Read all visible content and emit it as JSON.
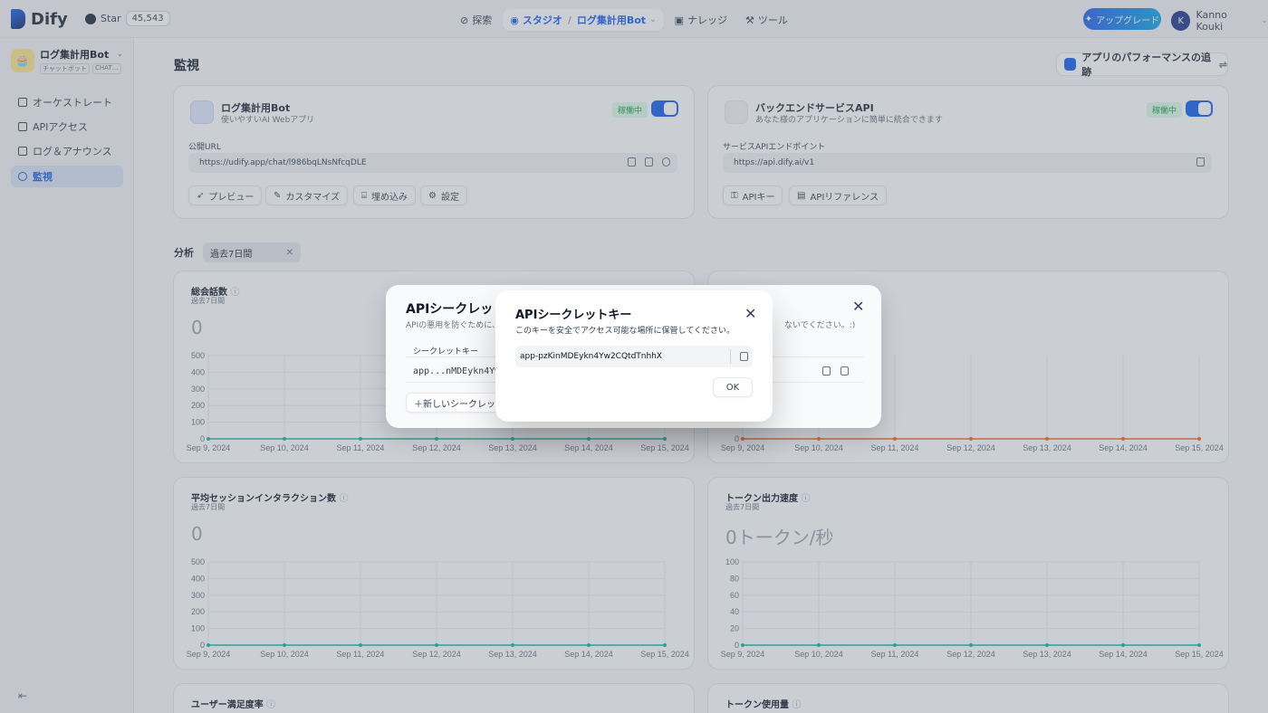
{
  "topbar": {
    "logo": "Dify",
    "github_label": "Star",
    "github_count": "45,543",
    "nav": {
      "explore": "探索",
      "studio": "スタジオ",
      "current_app": "ログ集計用Bot",
      "knowledge": "ナレッジ",
      "tools": "ツール"
    },
    "upgrade": "アップグレード",
    "user_initial": "K",
    "user_name": "Kanno Kouki"
  },
  "sidebar": {
    "app_name": "ログ集計用Bot",
    "tag1": "チャットボット",
    "tag2": "CHAT…",
    "items": [
      {
        "label": "オーケストレート",
        "icon": "layout-icon"
      },
      {
        "label": "APIアクセス",
        "icon": "terminal-icon"
      },
      {
        "label": "ログ＆アナウンス",
        "icon": "file-list-icon"
      },
      {
        "label": "監視",
        "icon": "monitor-icon"
      }
    ]
  },
  "main": {
    "title": "監視",
    "perf_button": "アプリのパフォーマンスの追跡",
    "webapp_card": {
      "title": "ログ集計用Bot",
      "subtitle": "使いやすいAI Webアプリ",
      "status": "稼働中",
      "url_label": "公開URL",
      "url": "https://udify.app/chat/l986bqLNsNfcqDLE",
      "buttons": [
        "プレビュー",
        "カスタマイズ",
        "埋め込み",
        "設定"
      ]
    },
    "api_card": {
      "title": "バックエンドサービスAPI",
      "subtitle": "あなた様のアプリケーションに簡単に統合できます",
      "status": "稼働中",
      "endpoint_label": "サービスAPIエンドポイント",
      "endpoint": "https://api.dify.ai/v1",
      "buttons": [
        "APIキー",
        "APIリファレンス"
      ]
    },
    "analysis_label": "分析",
    "period": "過去7日間"
  },
  "charts": {
    "total_conversations": {
      "title": "総会話数",
      "subtitle": "過去7日間",
      "value": "0"
    },
    "avg_interactions": {
      "title": "平均セッションインタラクション数",
      "subtitle": "過去7日間",
      "value": "0"
    },
    "token_speed": {
      "title": "トークン出力速度",
      "subtitle": "過去7日間",
      "value": "0トークン/秒"
    },
    "satisfaction": {
      "title": "ユーザー満足度率"
    },
    "token_usage": {
      "title": "トークン使用量"
    }
  },
  "chart_data": [
    {
      "type": "line",
      "x": [
        "Sep 9, 2024",
        "Sep 10, 2024",
        "Sep 11, 2024",
        "Sep 12, 2024",
        "Sep 13, 2024",
        "Sep 14, 2024",
        "Sep 15, 2024"
      ],
      "series": [
        {
          "values": [
            0,
            0,
            0,
            0,
            0,
            0,
            0
          ]
        }
      ],
      "yticks": [
        "0",
        "100",
        "200",
        "300",
        "400",
        "500"
      ],
      "ylim": [
        0,
        500
      ],
      "color": "#15b79e",
      "title": "総会話数"
    },
    {
      "type": "line",
      "x": [
        "Sep 9, 2024",
        "Sep 10, 2024",
        "Sep 11, 2024",
        "Sep 12, 2024",
        "Sep 13, 2024",
        "Sep 14, 2024",
        "Sep 15, 2024"
      ],
      "series": [
        {
          "values": [
            0,
            0,
            0,
            0,
            0,
            0,
            0
          ]
        }
      ],
      "yticks": [
        "0"
      ],
      "ylim": [
        0,
        500
      ],
      "color": "#fb6514",
      "title": ""
    },
    {
      "type": "line",
      "x": [
        "Sep 9, 2024",
        "Sep 10, 2024",
        "Sep 11, 2024",
        "Sep 12, 2024",
        "Sep 13, 2024",
        "Sep 14, 2024",
        "Sep 15, 2024"
      ],
      "series": [
        {
          "values": [
            0,
            0,
            0,
            0,
            0,
            0,
            0
          ]
        }
      ],
      "yticks": [
        "0",
        "100",
        "200",
        "300",
        "400",
        "500"
      ],
      "ylim": [
        0,
        500
      ],
      "color": "#15b79e",
      "title": "平均セッションインタラクション数"
    },
    {
      "type": "line",
      "x": [
        "Sep 9, 2024",
        "Sep 10, 2024",
        "Sep 11, 2024",
        "Sep 12, 2024",
        "Sep 13, 2024",
        "Sep 14, 2024",
        "Sep 15, 2024"
      ],
      "series": [
        {
          "values": [
            0,
            0,
            0,
            0,
            0,
            0,
            0
          ]
        }
      ],
      "yticks": [
        "0",
        "20",
        "40",
        "60",
        "80",
        "100"
      ],
      "ylim": [
        0,
        100
      ],
      "color": "#15b79e",
      "title": "トークン出力速度"
    }
  ],
  "dialog_back": {
    "title": "APIシークレットキー",
    "desc": "APIの悪用を防ぐために、",
    "desc_tail": "ないでください。:)",
    "col_header": "シークレットキー",
    "key_masked": "app...nMDEykn4Yw",
    "new_key_button": "＋新しいシークレットキー"
  },
  "dialog": {
    "title": "APIシークレットキー",
    "desc": "このキーを安全でアクセス可能な場所に保管してください。",
    "key": "app-pzKinMDEykn4Yw2CQtdTnhhX",
    "ok": "OK"
  }
}
